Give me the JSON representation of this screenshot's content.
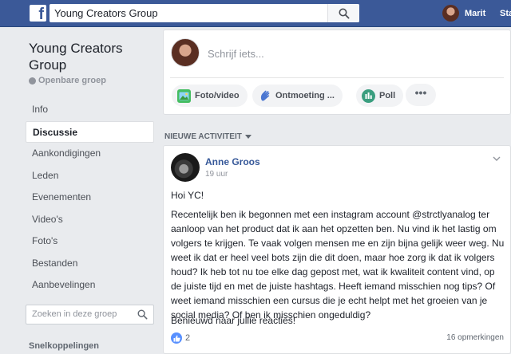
{
  "topbar": {
    "logo_letter": "f",
    "search_value": "Young Creators Group",
    "user_name": "Marit",
    "nav_start": "Sta"
  },
  "group": {
    "title": "Young Creators Group",
    "privacy": "Openbare groep"
  },
  "sidebar": {
    "items": [
      {
        "label": "Info"
      },
      {
        "label": "Discussie",
        "active": true
      },
      {
        "label": "Aankondigingen"
      },
      {
        "label": "Leden"
      },
      {
        "label": "Evenementen"
      },
      {
        "label": "Video's"
      },
      {
        "label": "Foto's"
      },
      {
        "label": "Bestanden"
      },
      {
        "label": "Aanbevelingen"
      }
    ],
    "search_placeholder": "Zoeken in deze groep",
    "shortcuts_heading": "Snelkoppelingen"
  },
  "composer": {
    "placeholder": "Schrijf iets...",
    "actions": [
      {
        "label": "Foto/video",
        "icon": "photo-icon"
      },
      {
        "label": "Ontmoeting ...",
        "icon": "wave-icon"
      },
      {
        "label": "Poll",
        "icon": "poll-icon"
      }
    ],
    "more_label": "•••"
  },
  "feed": {
    "section_label": "NIEUWE ACTIVITEIT"
  },
  "post": {
    "author": "Anne Groos",
    "time": "19 uur",
    "greeting": "Hoi YC!",
    "body": "Recentelijk ben ik begonnen met een instagram account @strctlyanalog ter aanloop van het product dat ik aan het opzetten ben. Nu vind ik het lastig om volgers te krijgen. Te vaak volgen mensen me en zijn bijna gelijk weer weg. Nu weet ik dat er heel veel bots zijn die dit doen, maar hoe zorg ik dat ik volgers houd? Ik heb tot nu toe elke dag gepost met, wat ik kwaliteit content vind, op de juiste tijd en met de juiste hashtags. Heeft iemand misschien nog tips? Of weet iemand misschien een cursus die je echt helpt met het groeien van je social media? Of ben ik misschien ongeduldig?",
    "closing": "Benieuwd naar jullie reacties!",
    "likes": "2",
    "comments": "16 opmerkingen"
  },
  "colors": {
    "brand": "#3b5998",
    "link": "#365899",
    "background": "#e9ebee",
    "like": "#5890ff"
  }
}
